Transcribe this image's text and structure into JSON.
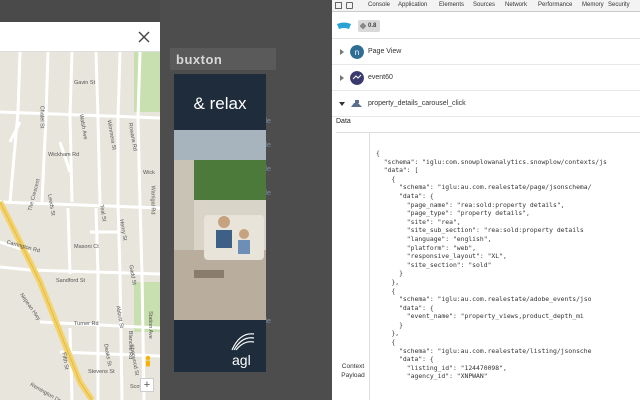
{
  "site": {
    "brand": "buxton",
    "side_links": [
      "ofile",
      "ofile",
      "ofile",
      "ofile",
      "ofile"
    ],
    "map": {
      "streets": [
        "Gavin St",
        "Chatel St",
        "Walsh Ave",
        "Wimmera St",
        "Rowans Rd",
        "Wickham Rd",
        "Wick",
        "Warrigal Rd",
        "The Crescent",
        "Leeds St",
        "Teal St",
        "Carrington Rd",
        "Henry St",
        "Masoni Ct",
        "Nepean Hwy",
        "Sandford St",
        "Turner Rd",
        "Blanche Rd",
        "Deaks St",
        "Fifth St",
        "Station Ave",
        "Abbott St",
        "Stevens St",
        "Remington Dr",
        "Gadd St",
        "Sherwood St",
        "Scott St"
      ],
      "zoom_in": "+"
    },
    "ad": {
      "tagline": "& relax",
      "logo": "agl"
    }
  },
  "devtools": {
    "tabs": [
      "Console",
      "Application",
      "Elements",
      "Sources",
      "Network",
      "Performance",
      "Memory",
      "Security"
    ],
    "active_tab": "Snowplow",
    "version": "0.8",
    "events": [
      {
        "label": "Page View",
        "icon": "page-view-icon",
        "color": "#2f6d95"
      },
      {
        "label": "event60",
        "icon": "event-icon",
        "color": "#3b3a6e"
      },
      {
        "label": "property_details_carousel_click",
        "icon": "unstruct-event-icon",
        "color": "#5b6f8a"
      }
    ],
    "data_label": "Data",
    "context_label": "Context Payload",
    "json_lines": [
      "{",
      "  \"schema\": \"iglu:com.snowplowanalytics.snowplow/contexts/js",
      "  \"data\": [",
      "    {",
      "      \"schema\": \"iglu:au.com.realestate/page/jsonschema/",
      "      \"data\": {",
      "        \"page_name\": \"rea:sold:property details\",",
      "        \"page_type\": \"property details\",",
      "        \"site\": \"rea\",",
      "        \"site_sub_section\": \"rea:sold:property details",
      "        \"language\": \"english\",",
      "        \"platform\": \"web\",",
      "        \"responsive_layout\": \"XL\",",
      "        \"site_section\": \"sold\"",
      "      }",
      "    },",
      "    {",
      "      \"schema\": \"iglu:au.com.realestate/adobe_events/jso",
      "      \"data\": {",
      "        \"event_name\": \"property_views,product_depth_mi",
      "      }",
      "    },",
      "    {",
      "      \"schema\": \"iglu:au.com.realestate/listing/jsonsche",
      "      \"data\": {",
      "        \"listing_id\": \"124470098\",",
      "        \"agency_id\": \"XNPWAN\""
    ]
  }
}
